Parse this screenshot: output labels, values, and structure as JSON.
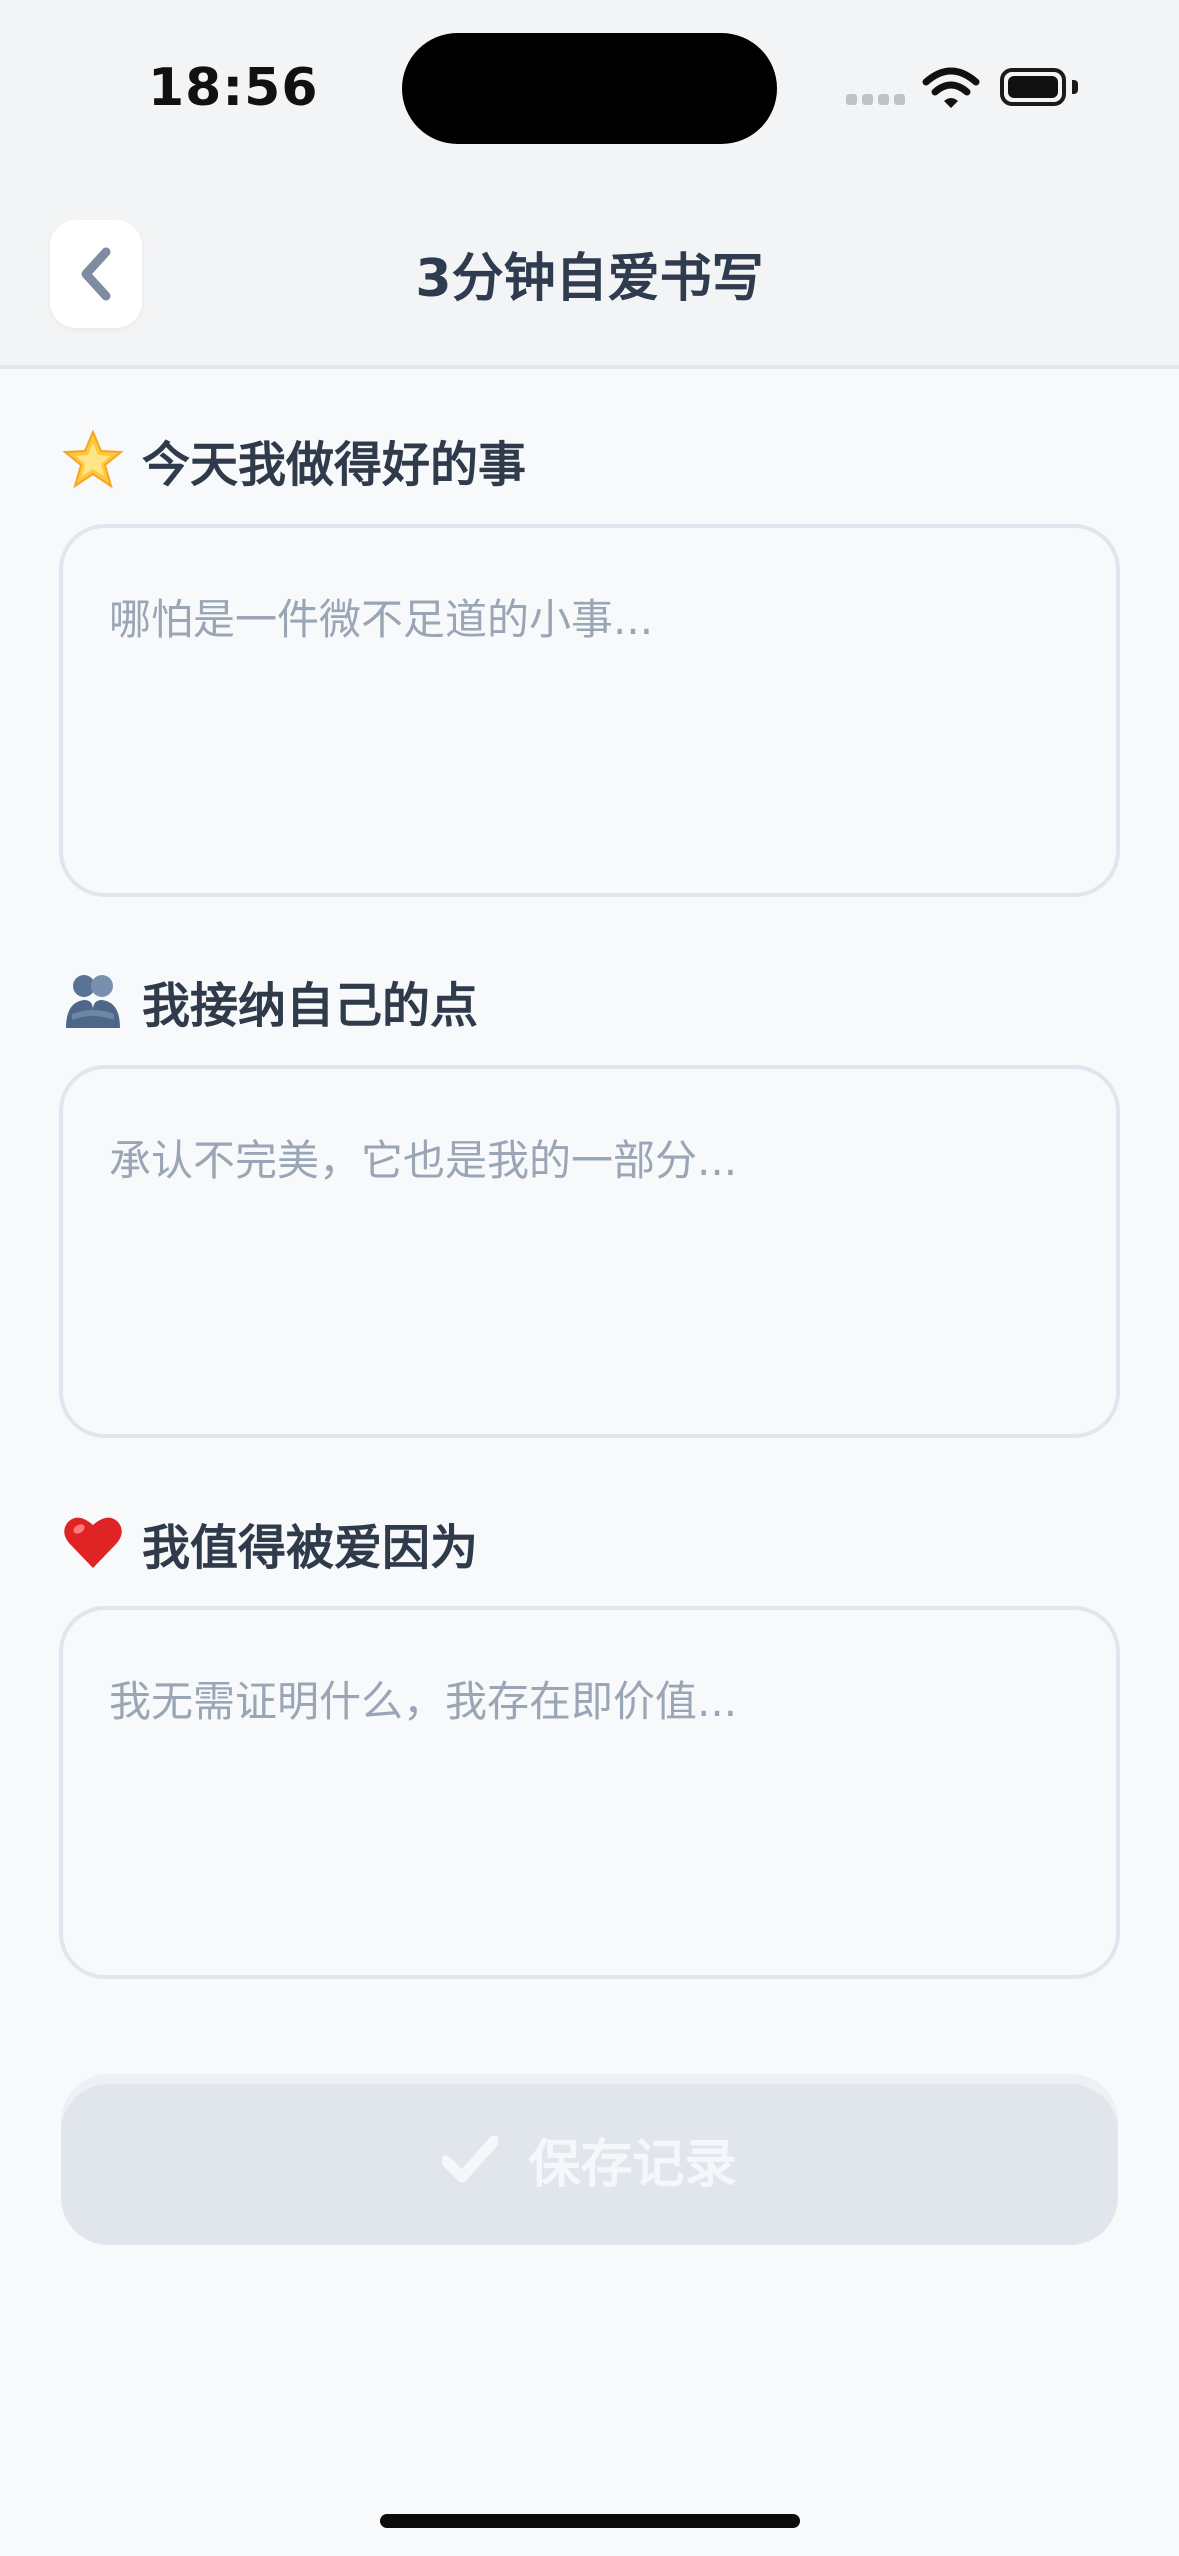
{
  "status_bar": {
    "time": "18:56"
  },
  "header": {
    "title": "3分钟自爱书写",
    "back_icon": "chevron-left-icon"
  },
  "sections": [
    {
      "emoji_icon": "glowing-star-icon",
      "label": "今天我做得好的事",
      "placeholder": "哪怕是一件微不足道的小事...",
      "value": ""
    },
    {
      "emoji_icon": "people-hugging-icon",
      "label": "我接纳自己的点",
      "placeholder": "承认不完美，它也是我的一部分...",
      "value": ""
    },
    {
      "emoji_icon": "red-heart-icon",
      "label": "我值得被爱因为",
      "placeholder": "我无需证明什么，我存在即价值...",
      "value": ""
    }
  ],
  "save_button": {
    "label": "保存记录",
    "icon": "checkmark-icon",
    "disabled": true
  },
  "colors": {
    "background": "#f7f9fb",
    "title": "#2f3b4e",
    "placeholder": "#9aa6b6",
    "border": "#dfe6ee",
    "button_disabled": "#e1e6ed"
  }
}
